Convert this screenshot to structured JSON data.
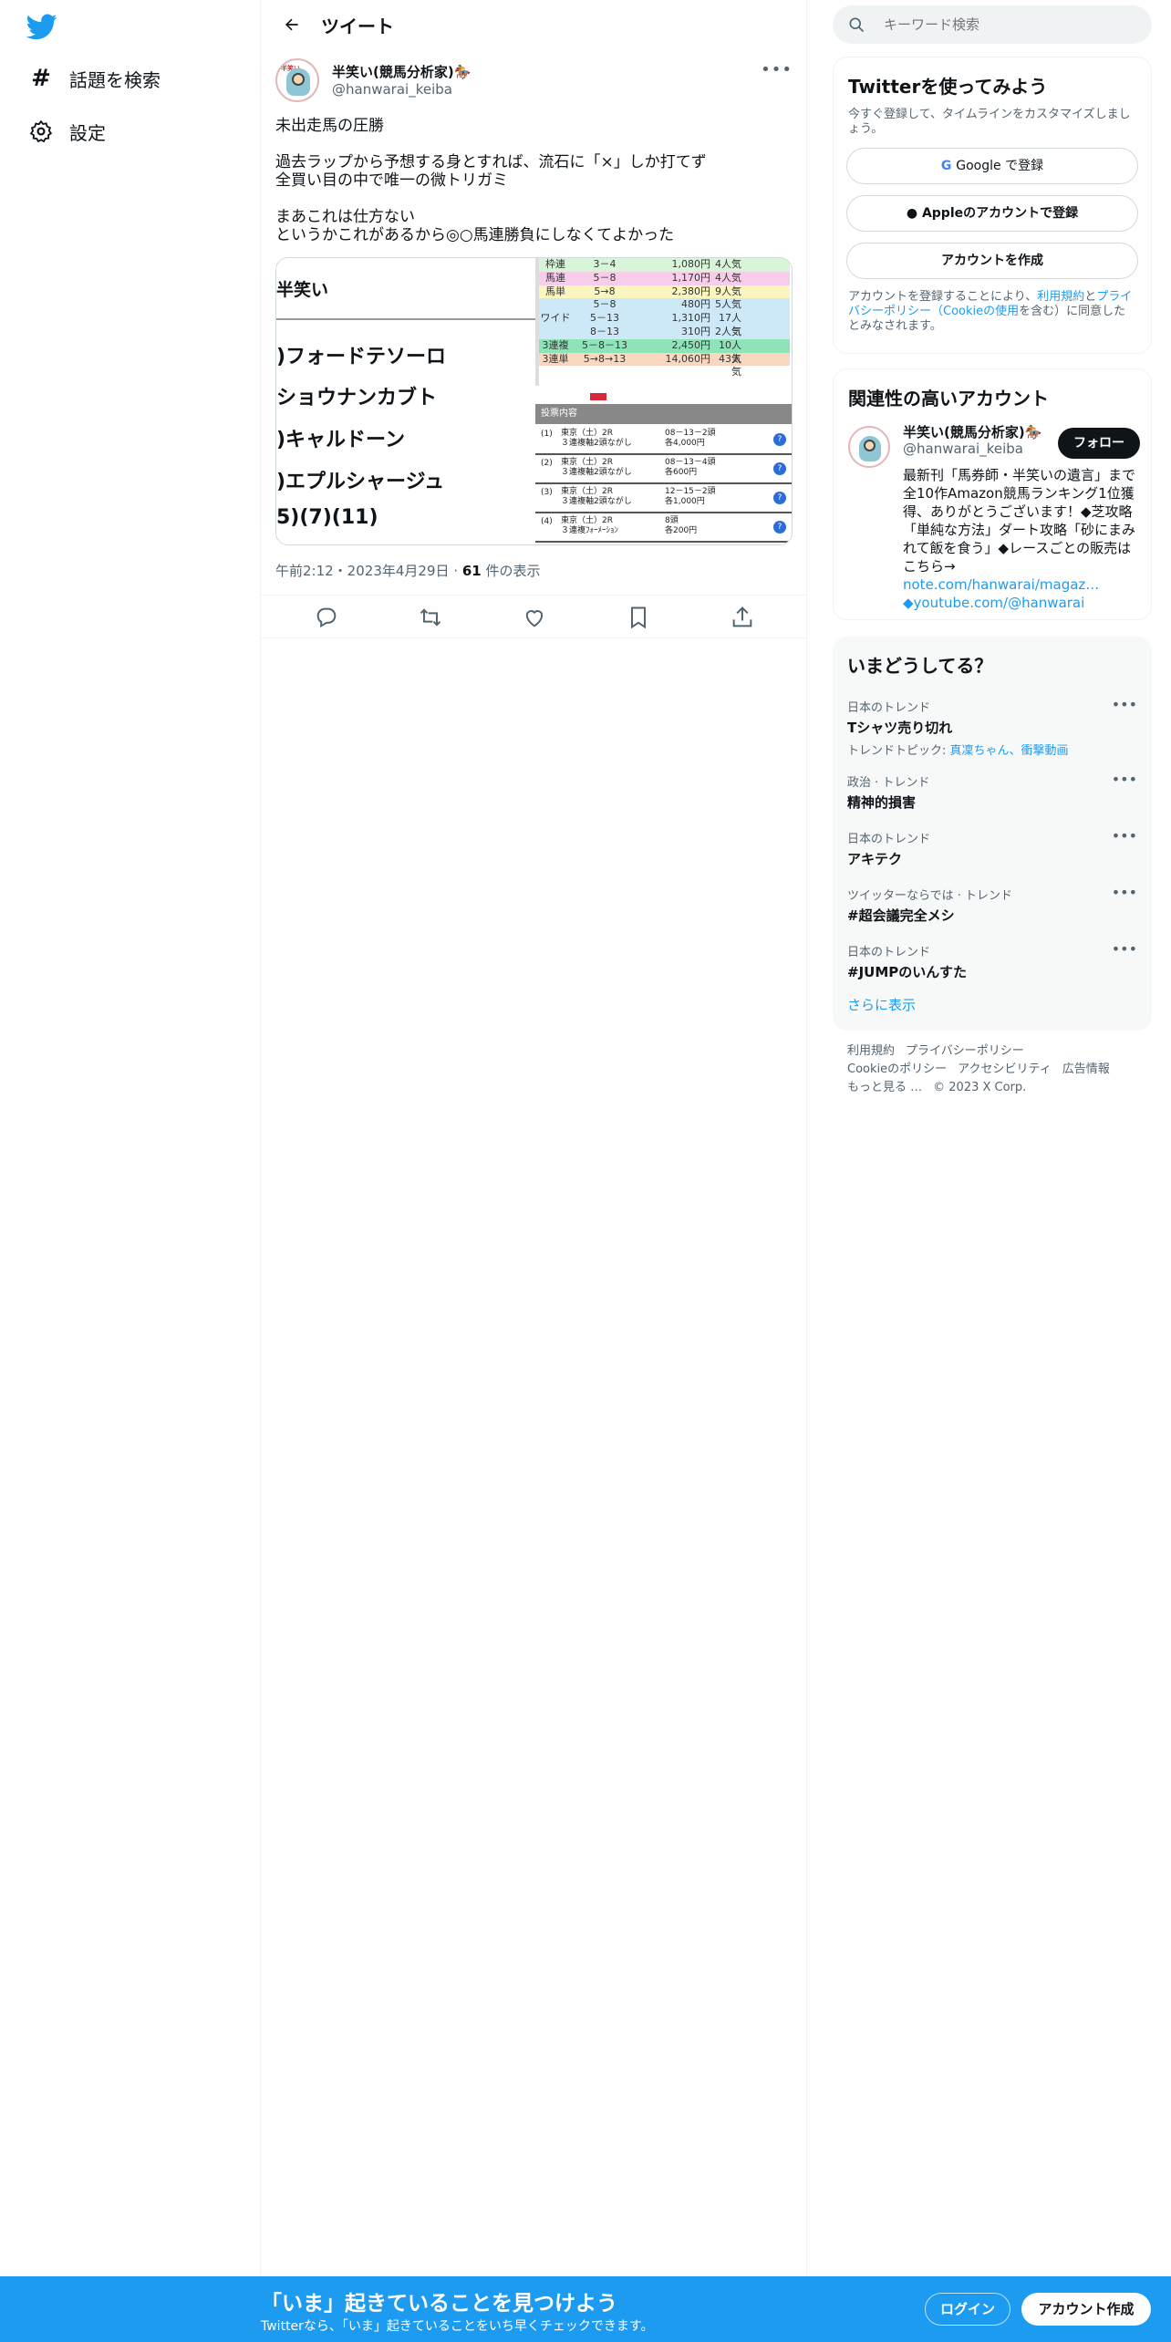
{
  "nav": {
    "explore_label": "話題を検索",
    "settings_label": "設定"
  },
  "header": {
    "title": "ツイート"
  },
  "tweet": {
    "author_name": "半笑い(競馬分析家)🏇",
    "author_handle": "@hanwarai_keiba",
    "text": "未出走馬の圧勝\n\n過去ラップから予想する身とすれば、流石に「×」しか打てず\n全買い目の中で唯一の微トリガミ\n\nまあこれは仕方ない\nというかこれがあるから◎○馬連勝負にしなくてよかった",
    "timestamp": "午前2:12・2023年4月29日",
    "views_count": "61",
    "views_label": " 件の表示"
  },
  "media": {
    "left_name": "半笑い",
    "horses": [
      ")フォードテソーロ",
      "ショウナンカブト",
      ")キャルドーン",
      ")エプルシャージュ",
      "5)(7)(11)"
    ],
    "payouts": [
      {
        "type": "枠連",
        "combo": "3－4",
        "amount": "1,080円",
        "pop": "4人気",
        "color": "#d8f5d8"
      },
      {
        "type": "馬連",
        "combo": "5－8",
        "amount": "1,170円",
        "pop": "4人気",
        "color": "#f7cdea"
      },
      {
        "type": "馬単",
        "combo": "5→8",
        "amount": "2,380円",
        "pop": "9人気",
        "color": "#fbf5c0"
      },
      {
        "type": "",
        "combo": "5－8",
        "amount": "480円",
        "pop": "5人気",
        "color": "#cde8f7"
      },
      {
        "type": "ワイド",
        "combo": "5－13",
        "amount": "1,310円",
        "pop": "17人気",
        "color": "#cde8f7"
      },
      {
        "type": "",
        "combo": "8－13",
        "amount": "310円",
        "pop": "2人気",
        "color": "#cde8f7"
      },
      {
        "type": "3連複",
        "combo": "5－8－13",
        "amount": "2,450円",
        "pop": "10人気",
        "color": "#8fe3b8"
      },
      {
        "type": "3連単",
        "combo": "5→8→13",
        "amount": "14,060円",
        "pop": "43人気",
        "color": "#f9d7c1"
      }
    ],
    "vote_header": "投票内容",
    "votes": [
      {
        "n": "(1)",
        "race": "東京（土）2R\n３連複軸2頭ながし",
        "bet": "08－13－2頭\n各4,000円"
      },
      {
        "n": "(2)",
        "race": "東京（土）2R\n３連複軸2頭ながし",
        "bet": "08－13－4頭\n各600円"
      },
      {
        "n": "(3)",
        "race": "東京（土）2R\n３連複軸2頭ながし",
        "bet": "12－15－2頭\n各1,000円"
      },
      {
        "n": "(4)",
        "race": "東京（土）2R\n３連複ﾌｫｰﾒｰｼｮﾝ",
        "bet": "8頭\n各200円"
      }
    ]
  },
  "sidebar": {
    "search_placeholder": "キーワード検索",
    "signup_card": {
      "title": "Twitterを使ってみよう",
      "subtitle": "今すぐ登録して、タイムラインをカスタマイズしましょう。",
      "google_label": "Google で登録",
      "apple_label": "Appleのアカウントで登録",
      "create_label": "アカウントを作成",
      "legal_prefix": "アカウントを登録することにより、",
      "legal_terms": "利用規約",
      "legal_and": "と",
      "legal_privacy": "プライバシーポリシー（Cookieの使用",
      "legal_suffix": "を含む）に同意したとみなされます。"
    },
    "related": {
      "title": "関連性の高いアカウント",
      "name": "半笑い(競馬分析家)🏇",
      "handle": "@hanwarai_keiba",
      "follow_label": "フォロー",
      "bio": "最新刊「馬券師・半笑いの遺言」まで全10作Amazon競馬ランキング1位獲得、ありがとうございます！◆芝攻略「単純な方法」ダート攻略「砂にまみれて飯を食う」◆レースごとの販売はこちら→",
      "bio_link1": "note.com/hanwarai/magaz…",
      "bio_link2": "◆youtube.com/@hanwarai"
    },
    "trends": {
      "title": "いまどうしてる？",
      "items": [
        {
          "context": "日本のトレンド",
          "name": "Tシャツ売り切れ",
          "extra": "トレンドトピック: ",
          "extra_link": "真凜ちゃん、衝撃動画"
        },
        {
          "context": "政治 · トレンド",
          "name": "精神的損害",
          "extra": "",
          "extra_link": ""
        },
        {
          "context": "日本のトレンド",
          "name": "アキテク",
          "extra": "",
          "extra_link": ""
        },
        {
          "context": "ツイッターならでは · トレンド",
          "name": "#超会議完全メシ",
          "extra": "",
          "extra_link": ""
        },
        {
          "context": "日本のトレンド",
          "name": "#JUMPのいんすた",
          "extra": "",
          "extra_link": ""
        }
      ],
      "show_more": "さらに表示"
    },
    "footer": {
      "links": [
        "利用規約",
        "プライバシーポリシー",
        "Cookieのポリシー",
        "アクセシビリティ",
        "広告情報",
        "もっと見る …",
        "© 2023 X Corp."
      ]
    }
  },
  "banner": {
    "title": "「いま」起きていることを見つけよう",
    "subtitle": "Twitterなら、「いま」起きていることをいち早くチェックできます。",
    "login_label": "ログイン",
    "signup_label": "アカウント作成"
  },
  "colors": {
    "accent": "#1d9bf0",
    "text": "#0f1419",
    "muted": "#536471"
  }
}
